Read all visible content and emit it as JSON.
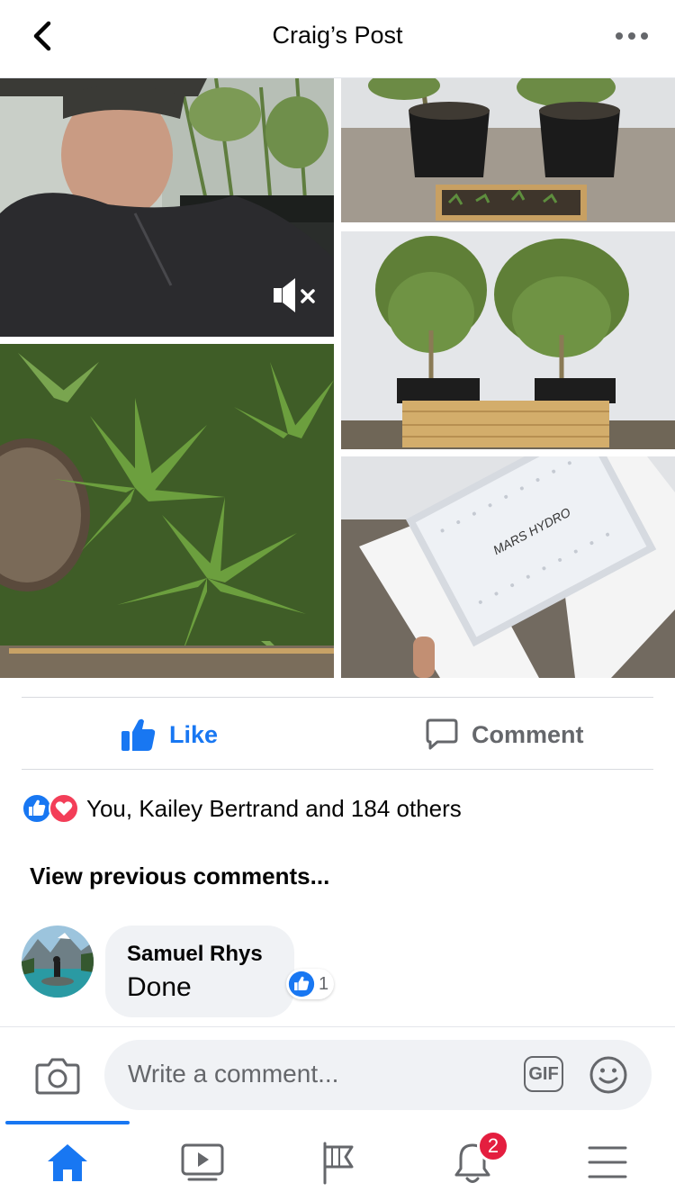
{
  "header": {
    "title": "Craig’s Post",
    "back_icon": "back-arrow-icon",
    "more_icon": "more-dots-icon"
  },
  "media": {
    "video_muted_icon": "volume-muted-icon",
    "photos": [
      "video-man-in-grow-tent",
      "two-potted-plants-with-seed-tray",
      "two-bushy-plants-in-wooden-box",
      "cannabis-leaves-closeup",
      "led-grow-light-in-foam"
    ],
    "light_brand": "MARS HYDRO"
  },
  "actions": {
    "like_label": "Like",
    "comment_label": "Comment"
  },
  "reactions": {
    "text": "You, Kailey Bertrand and 184 others",
    "icons": [
      "like-reaction-icon",
      "love-reaction-icon"
    ]
  },
  "comments": {
    "view_previous": "View previous comments...",
    "items": [
      {
        "author": "Samuel Rhys",
        "text": "Done",
        "like_count": "1"
      }
    ]
  },
  "composer": {
    "placeholder": "Write a comment...",
    "gif_label": "GIF"
  },
  "tabbar": {
    "notifications_badge": "2"
  },
  "colors": {
    "accent": "#1877f2",
    "love": "#f33e58",
    "badge": "#e41e3f",
    "text_secondary": "#65676b"
  }
}
